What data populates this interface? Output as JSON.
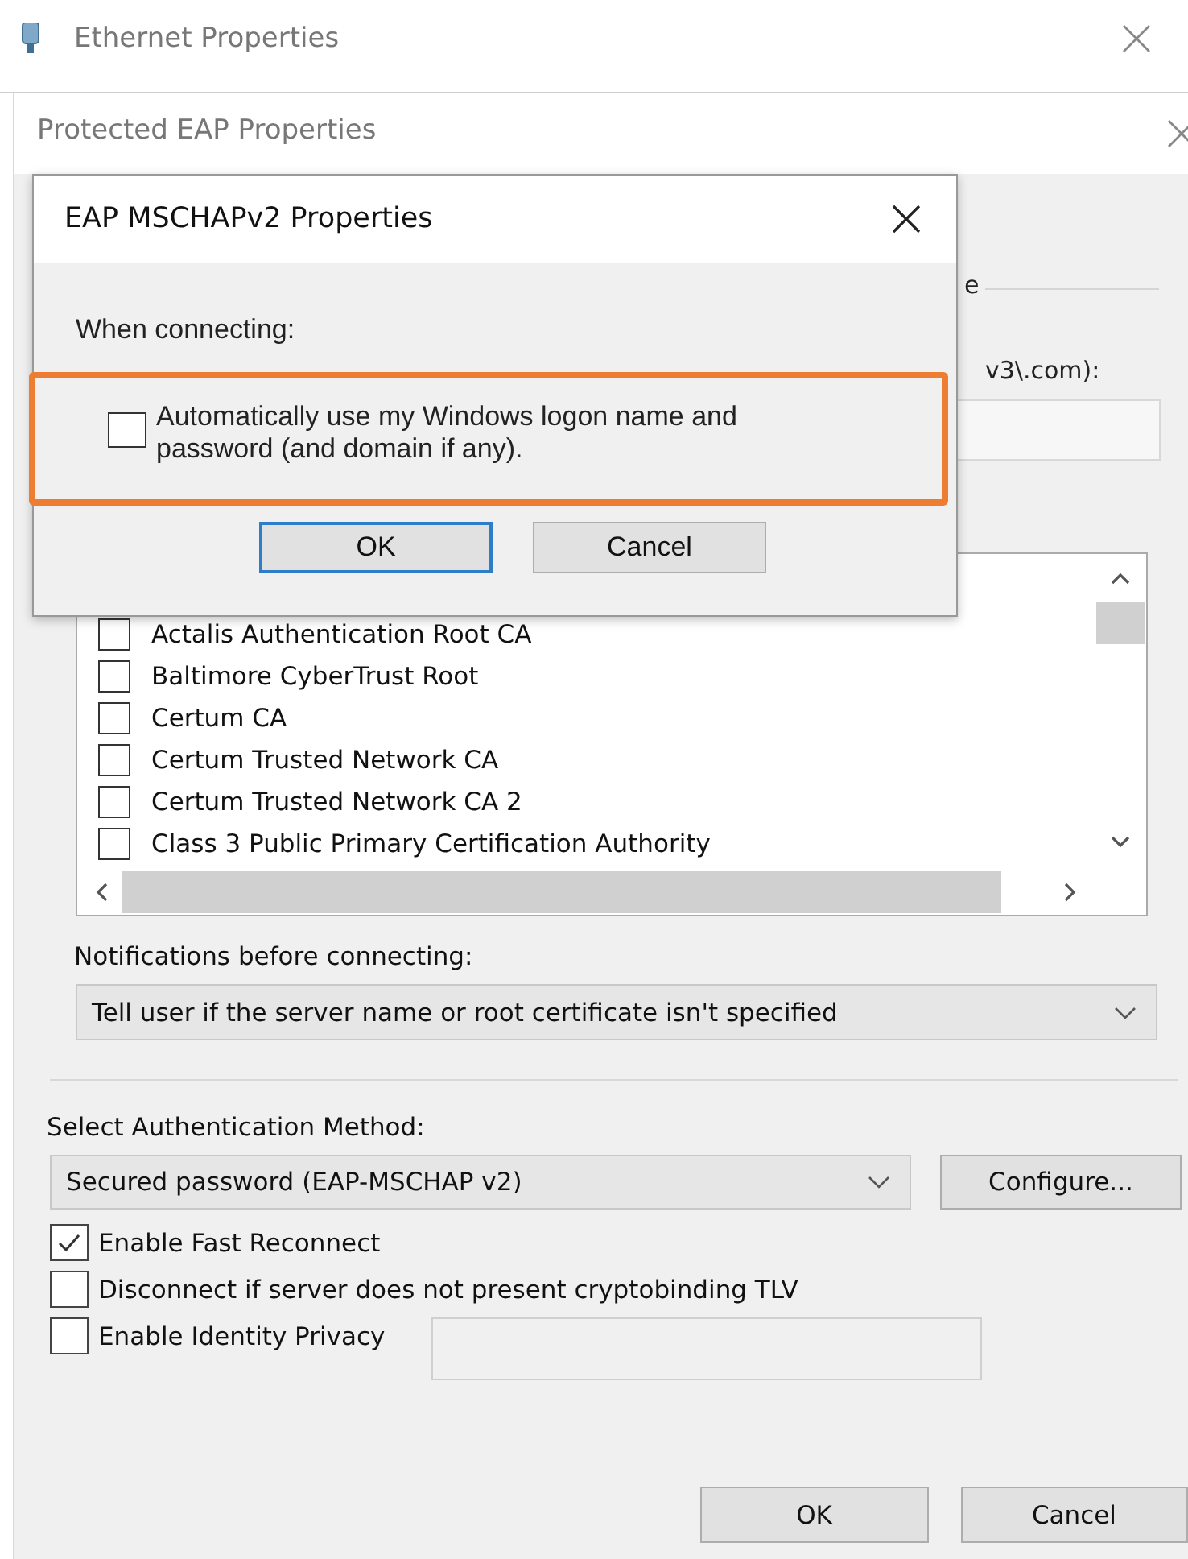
{
  "background_window": {
    "title": "Ethernet Properties"
  },
  "window": {
    "title": "Protected EAP Properties",
    "partial_label_1": "e",
    "partial_label_2": "v3\\.com):",
    "certificates": [
      {
        "label": "Actalis Authentication Root CA",
        "checked": false
      },
      {
        "label": "Baltimore CyberTrust Root",
        "checked": false
      },
      {
        "label": "Certum CA",
        "checked": false
      },
      {
        "label": "Certum Trusted Network CA",
        "checked": false
      },
      {
        "label": "Certum Trusted Network CA 2",
        "checked": false
      },
      {
        "label": "Class 3 Public Primary Certification Authority",
        "checked": false
      }
    ],
    "notifications_label": "Notifications before connecting:",
    "notifications_value": "Tell user if the server name or root certificate isn't specified",
    "auth_label": "Select Authentication Method:",
    "auth_value": "Secured password (EAP-MSCHAP v2)",
    "configure_button": "Configure...",
    "options": [
      {
        "label": "Enable Fast Reconnect",
        "checked": true
      },
      {
        "label": "Disconnect if server does not present cryptobinding TLV",
        "checked": false
      },
      {
        "label": "Enable Identity Privacy",
        "checked": false
      }
    ],
    "buttons": [
      "OK",
      "Cancel"
    ]
  },
  "dialog": {
    "title": "EAP MSCHAPv2 Properties",
    "prompt": "When connecting:",
    "option": {
      "label": "Automatically use my Windows logon name and password (and domain if any).",
      "checked": false
    },
    "buttons": [
      "OK",
      "Cancel"
    ]
  }
}
